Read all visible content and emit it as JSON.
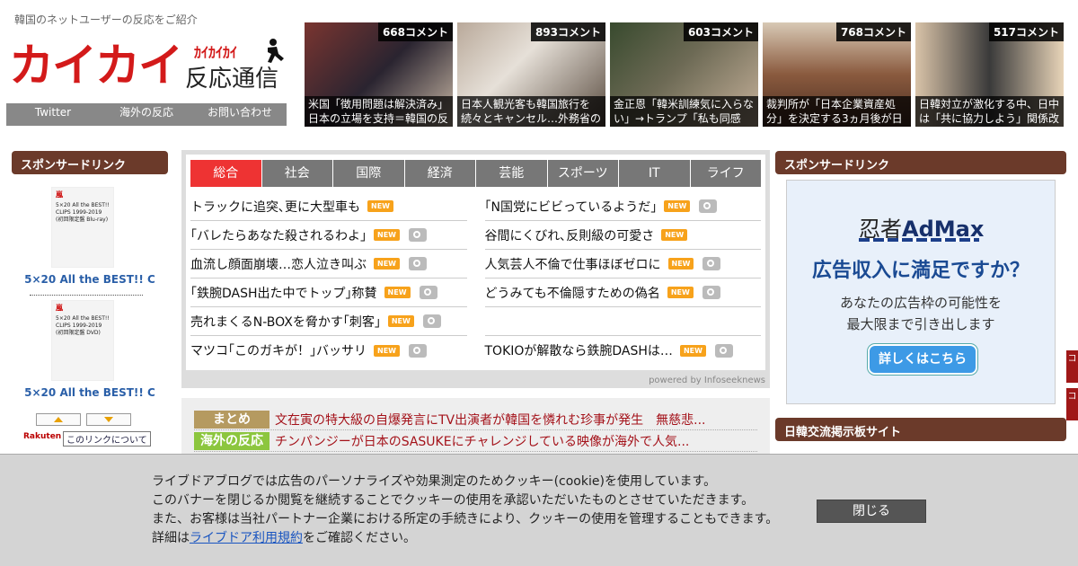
{
  "header": {
    "tagline": "韓国のネットユーザーの反応をご紹介",
    "logo_main": "カイカイ",
    "logo_kana": "ｶｲｶｲｶｲ",
    "logo_sub": "反応通信"
  },
  "nav": [
    "Twitter",
    "海外の反応",
    "お問い合わせ"
  ],
  "thumbs": [
    {
      "count": "668コメント",
      "caption": "米国「徴用問題は解決済み」日本の立場を支持＝韓国の反",
      "bg": "#5a2f2a"
    },
    {
      "count": "893コメント",
      "caption": "日本人観光客も韓国旅行を続々とキャンセル…外務省の",
      "bg": "#8e7c6e"
    },
    {
      "count": "603コメント",
      "caption": "金正恩「韓米訓練気に入らない」→トランプ「私も同感",
      "bg": "#4b5840"
    },
    {
      "count": "768コメント",
      "caption": "裁判所が「日本企業資産処分」を決定する3ヵ月後が日",
      "bg": "#6e4a3a"
    },
    {
      "count": "517コメント",
      "caption": "日韓対立が激化する中、日中は「共に協力しよう」関係改",
      "bg": "#6a6a6a"
    }
  ],
  "left": {
    "heading": "スポンサードリンク",
    "products": [
      {
        "brand": "嵐",
        "cover": "5×20 All the BEST!! CLIPS 1999-2019 (初回限定盤 Blu-ray)",
        "title": "5×20 All the BEST!! C"
      },
      {
        "brand": "嵐",
        "cover": "5×20 All the BEST!! CLIPS 1999-2019 (初回限定盤 DVD)",
        "title": "5×20 All the BEST!! C"
      }
    ],
    "rakuten": "Rakuten",
    "about": "このリンクについて"
  },
  "news": {
    "tabs": [
      "総合",
      "社会",
      "国際",
      "経済",
      "芸能",
      "スポーツ",
      "IT",
      "ライフ"
    ],
    "active_tab": "総合",
    "new_label": "NEW",
    "left": [
      {
        "text": "トラックに追突､更に大型車も",
        "cam": false
      },
      {
        "text": "｢バレたらあなた殺されるわよ｣",
        "cam": true
      },
      {
        "text": "血流し顔面崩壊…恋人泣き叫ぶ",
        "cam": true
      },
      {
        "text": "｢鉄腕DASH出た中でトップ｣称賛",
        "cam": true
      },
      {
        "text": "売れまくるN-BOXを脅かす｢刺客｣",
        "cam": true
      },
      {
        "text": "マツコ｢このガキが！｣バッサリ",
        "cam": true
      }
    ],
    "right": [
      {
        "text": "｢N国党にビビっているようだ｣",
        "cam": true
      },
      {
        "text": "谷間にくびれ､反則級の可愛さ",
        "cam": false
      },
      {
        "text": "人気芸人不倫で仕事ほぼゼロに",
        "cam": true
      },
      {
        "text": "どうみても不倫隠すための偽名",
        "cam": true
      },
      {
        "text": "",
        "cam": false
      },
      {
        "text": "TOKIOが解散なら鉄腕DASHは…",
        "cam": true
      }
    ],
    "powered": "powered by Infoseeknews"
  },
  "matome": [
    {
      "tag": "まとめ",
      "color": "#b59a60",
      "text": "文在寅の特大級の自爆発言にTV出演者が韓国を憐れむ珍事が発生　無慈悲..."
    },
    {
      "tag": "海外の反応",
      "color": "#8cc63e",
      "text": "チンパンジーが日本のSASUKEにチャレンジしている映像が海外で人気..."
    }
  ],
  "right": {
    "heading1": "スポンサードリンク",
    "heading2": "日韓交流掲示板サイト",
    "ad_brand1": "忍者",
    "ad_brand2": "AdMax",
    "ad_headline": "広告収入に満足ですか？",
    "ad_line1": "あなたの広告枠の可能性を",
    "ad_line2": "最大限まで引き出します",
    "ad_button": "詳しくはこちら",
    "edge": [
      "コ",
      "コ"
    ]
  },
  "cookie": {
    "line1": "ライブドアブログでは広告のパーソナライズや効果測定のためクッキー(cookie)を使用しています。",
    "line2": "このバナーを閉じるか閲覧を継続することでクッキーの使用を承認いただいたものとさせていただきます。",
    "line3": "また、お客様は当社パートナー企業における所定の手続きにより、クッキーの使用を管理することもできます。",
    "line4_pre": "詳細は",
    "line4_link": "ライブドア利用規約",
    "line4_post": "をご確認ください。",
    "close": "閉じる"
  }
}
